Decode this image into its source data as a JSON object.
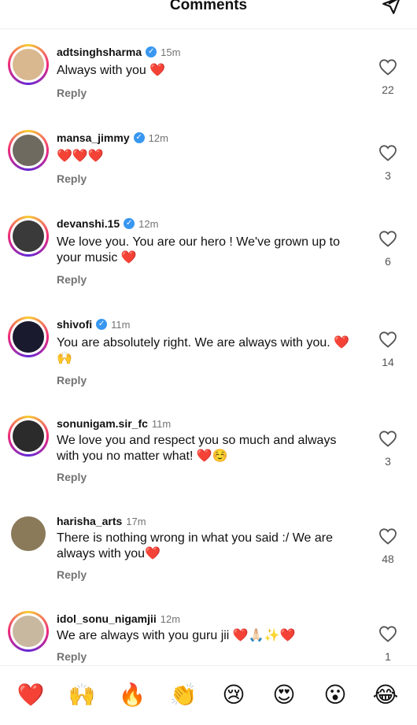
{
  "header": {
    "title": "Comments",
    "send_icon": "paper-plane-icon"
  },
  "comments": [
    {
      "username": "adtsinghsharma",
      "verified": true,
      "time": "15m",
      "text": "Always with you ❤️",
      "reply": "Reply",
      "likes": "22",
      "avatar_color": "#d9b890"
    },
    {
      "username": "mansa_jimmy",
      "verified": true,
      "time": "12m",
      "text": "❤️❤️❤️",
      "reply": "Reply",
      "likes": "3",
      "avatar_color": "#6f6a5f"
    },
    {
      "username": "devanshi.15",
      "verified": true,
      "time": "12m",
      "text": "We love you. You are our hero !  We've grown up to your music ❤️",
      "reply": "Reply",
      "likes": "6",
      "avatar_color": "#3a3a3a"
    },
    {
      "username": "shivofi",
      "verified": true,
      "time": "11m",
      "text": "You are absolutely right. We are always with you. ❤️🙌",
      "reply": "Reply",
      "likes": "14",
      "avatar_color": "#1a1a2e"
    },
    {
      "username": "sonunigam.sir_fc",
      "verified": false,
      "time": "11m",
      "text": "We love you and respect you so much and always with you no matter what! ❤️☺️",
      "reply": "Reply",
      "likes": "3",
      "avatar_color": "#2b2b2b"
    },
    {
      "username": "harisha_arts",
      "verified": false,
      "time": "17m",
      "text": "There is nothing wrong in what you said :/ We are always with you❤️",
      "reply": "Reply",
      "likes": "48",
      "avatar_color": "#8a7a5a"
    },
    {
      "username": "idol_sonu_nigamjii",
      "verified": false,
      "time": "12m",
      "text": "We are always with you guru jii ❤️🙏🏻✨❤️",
      "reply": "Reply",
      "likes": "1",
      "avatar_color": "#c9b8a0"
    }
  ],
  "reactions": [
    "❤️",
    "🙌",
    "🔥",
    "👏",
    "😢",
    "😍",
    "😮",
    "😂"
  ]
}
